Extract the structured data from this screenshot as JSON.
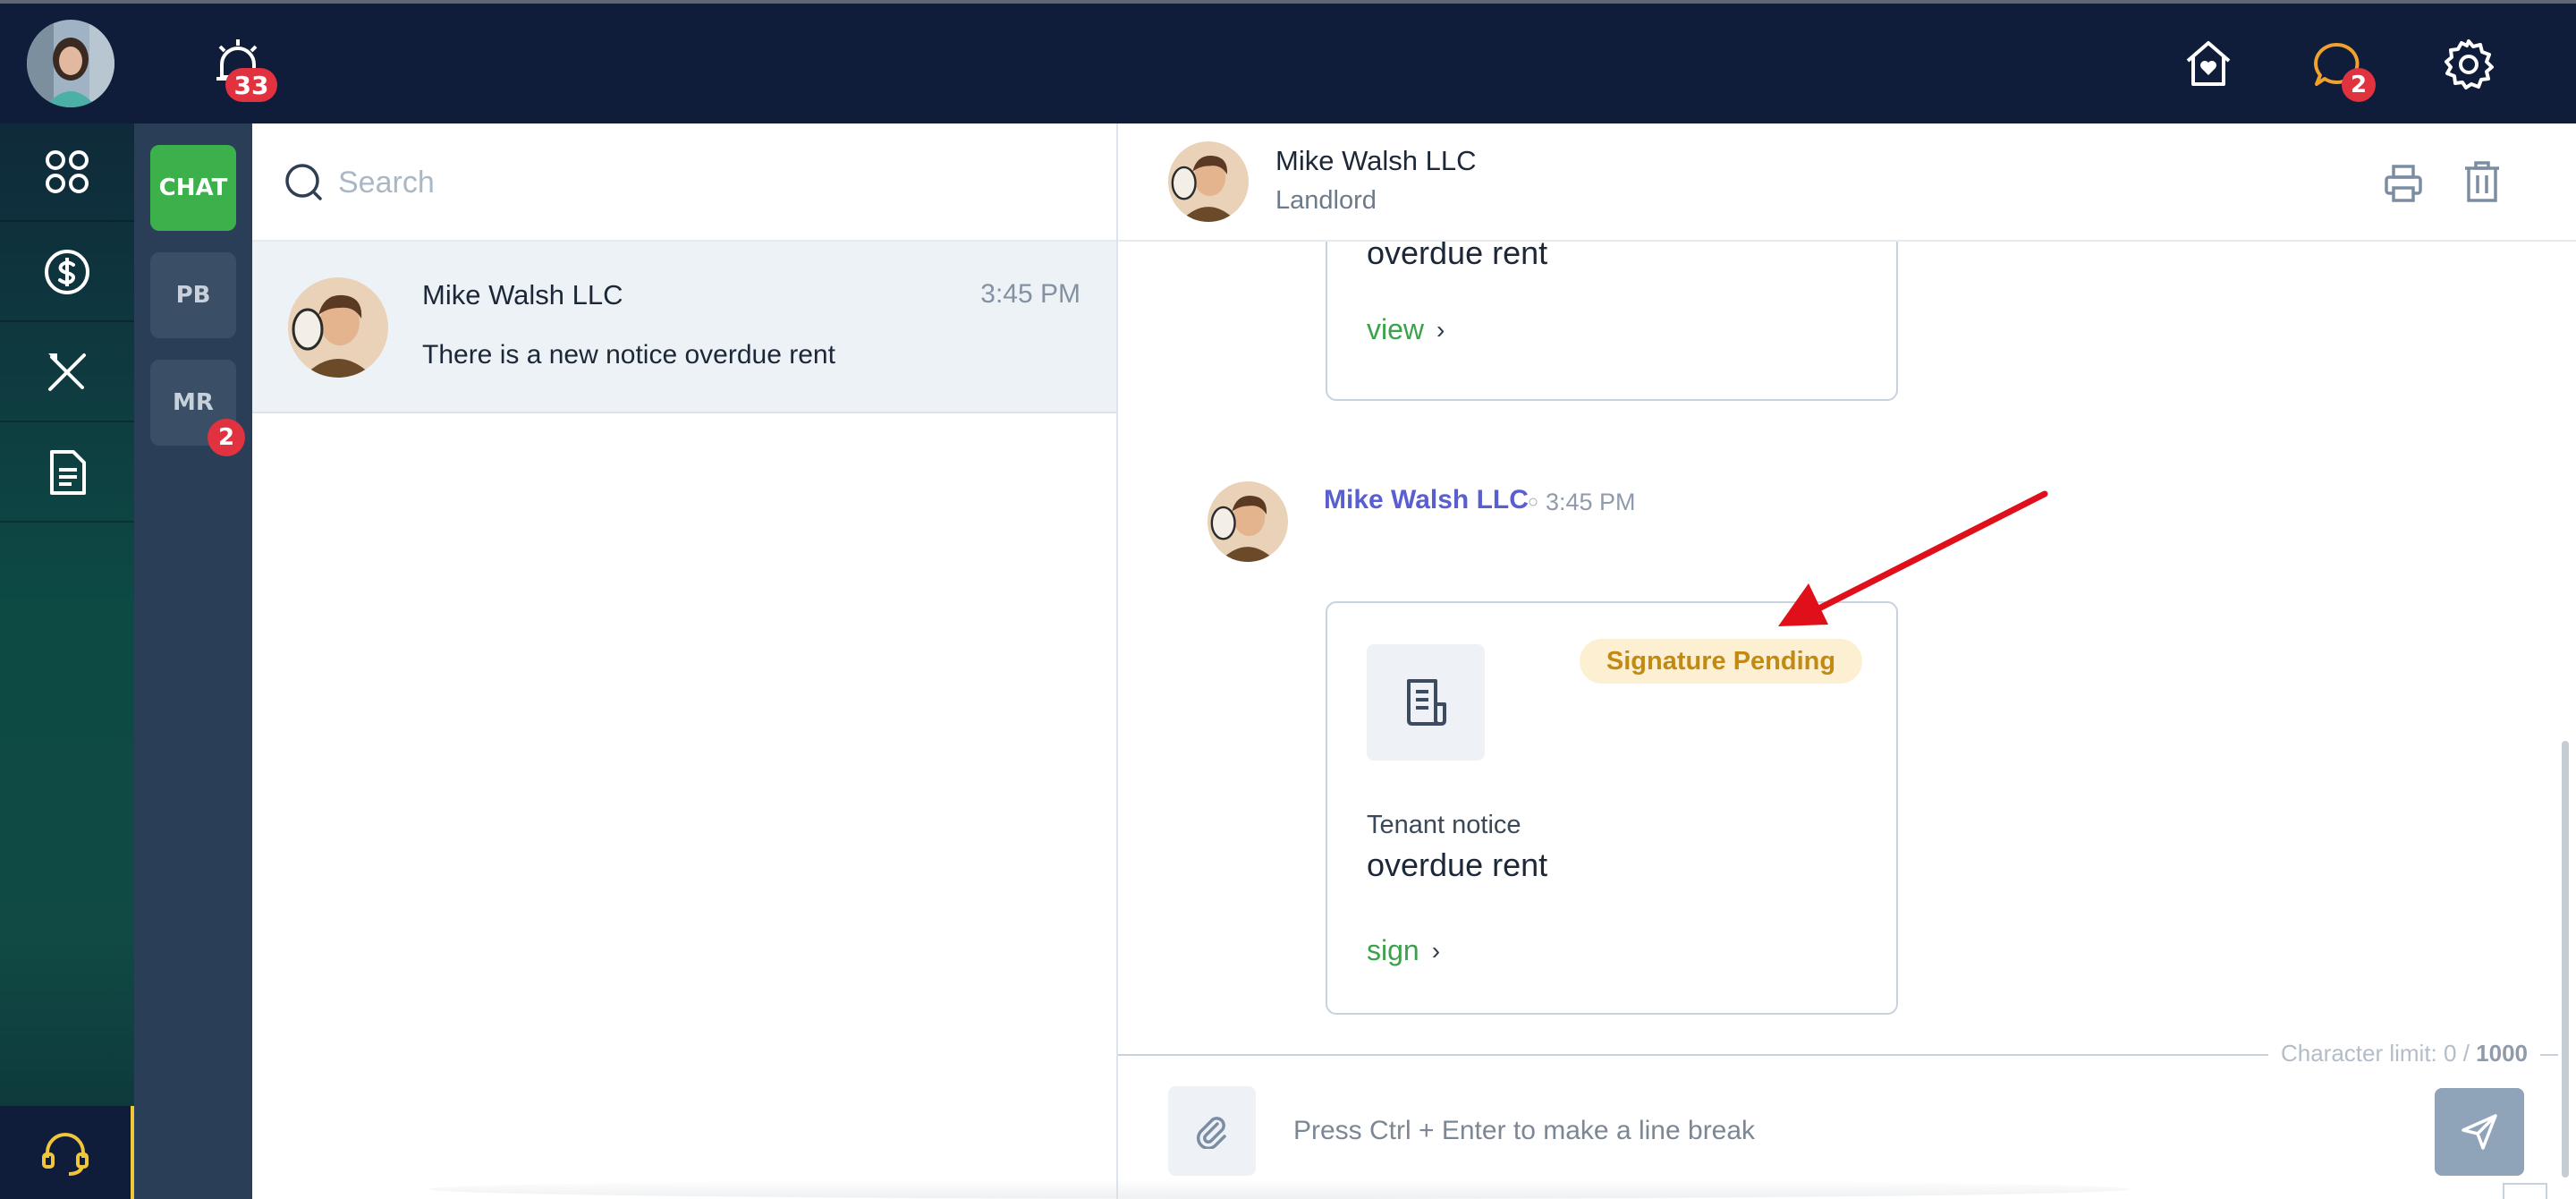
{
  "topbar": {
    "alerts_count": "33",
    "chat_count": "2"
  },
  "leftnav": {
    "items": [
      "apps",
      "payments",
      "maintenance",
      "documents"
    ],
    "support": "support"
  },
  "chat_types": [
    {
      "label": "CHAT",
      "active": true
    },
    {
      "label": "PB",
      "active": false
    },
    {
      "label": "MR",
      "active": false,
      "badge": "2"
    }
  ],
  "search": {
    "placeholder": "Search"
  },
  "conversations": [
    {
      "name": "Mike Walsh LLC",
      "time": "3:45 PM",
      "preview": "There is a new notice overdue rent"
    }
  ],
  "chat": {
    "header": {
      "name": "Mike Walsh LLC",
      "role": "Landlord"
    },
    "previous_card": {
      "title": "overdue rent",
      "link": "view"
    },
    "message": {
      "sender": "Mike Walsh LLC",
      "time": "3:45 PM",
      "card": {
        "status": "Signature Pending",
        "subtitle": "Tenant notice",
        "title": "overdue rent",
        "link": "sign"
      }
    },
    "char_limit": {
      "label": "Character limit: 0 /",
      "max": "1000"
    },
    "input": {
      "placeholder": "Press Ctrl + Enter to make a line break"
    }
  },
  "colors": {
    "topbar": "#0f1d3a",
    "accent_green": "#3cb04a",
    "badge_red": "#e0323f",
    "sender_purple": "#5a5fd0",
    "pending_bg": "#fdf0d2",
    "pending_text": "#c28a12"
  }
}
